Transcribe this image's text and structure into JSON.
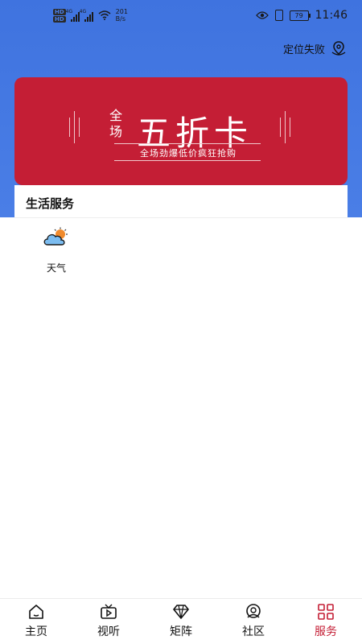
{
  "status_bar": {
    "hd1": "HD",
    "hd2": "HD",
    "net1": "4G",
    "net2": "4G",
    "speed_value": "201",
    "speed_unit": "B/s",
    "battery": "79",
    "time": "11:46"
  },
  "header": {
    "location_label": "定位失败"
  },
  "banner": {
    "small_chars": "全\n场",
    "title": "五折卡",
    "subtitle": "全场劲爆低价疯狂抢购"
  },
  "section": {
    "title": "生活服务"
  },
  "services": [
    {
      "label": "天气",
      "icon": "weather-cloud-sun-icon"
    }
  ],
  "bottom_nav": {
    "active_color": "#c41e35",
    "items": [
      {
        "label": "主页",
        "icon": "home-icon"
      },
      {
        "label": "视听",
        "icon": "video-icon"
      },
      {
        "label": "矩阵",
        "icon": "diamond-icon"
      },
      {
        "label": "社区",
        "icon": "community-icon"
      },
      {
        "label": "服务",
        "icon": "grid-icon",
        "active": true
      }
    ]
  }
}
